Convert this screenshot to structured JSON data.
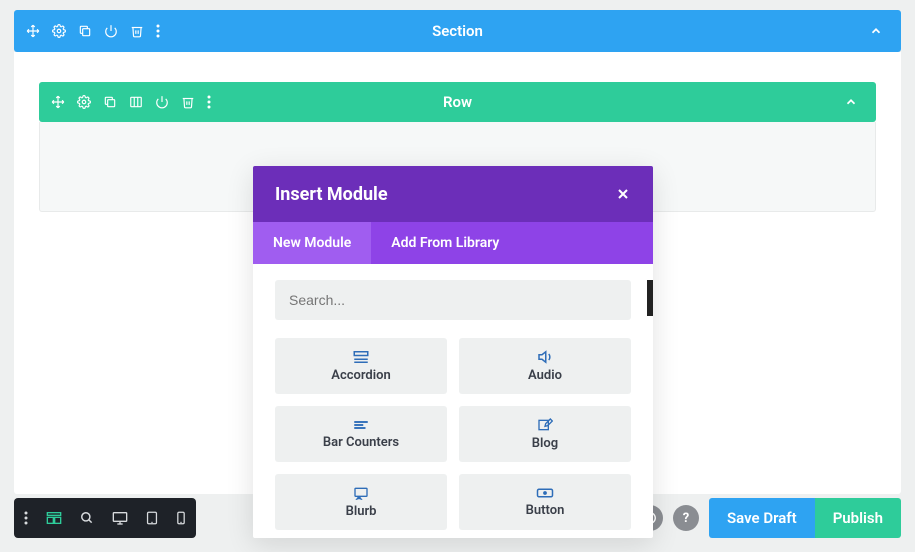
{
  "section": {
    "title": "Section"
  },
  "row": {
    "title": "Row"
  },
  "modal": {
    "title": "Insert Module",
    "tabs": {
      "new": "New Module",
      "library": "Add From Library"
    },
    "search_placeholder": "Search...",
    "modules": [
      {
        "name": "Accordion"
      },
      {
        "name": "Audio"
      },
      {
        "name": "Bar Counters"
      },
      {
        "name": "Blog"
      },
      {
        "name": "Blurb"
      },
      {
        "name": "Button"
      }
    ]
  },
  "footer": {
    "save_draft": "Save Draft",
    "publish": "Publish"
  }
}
